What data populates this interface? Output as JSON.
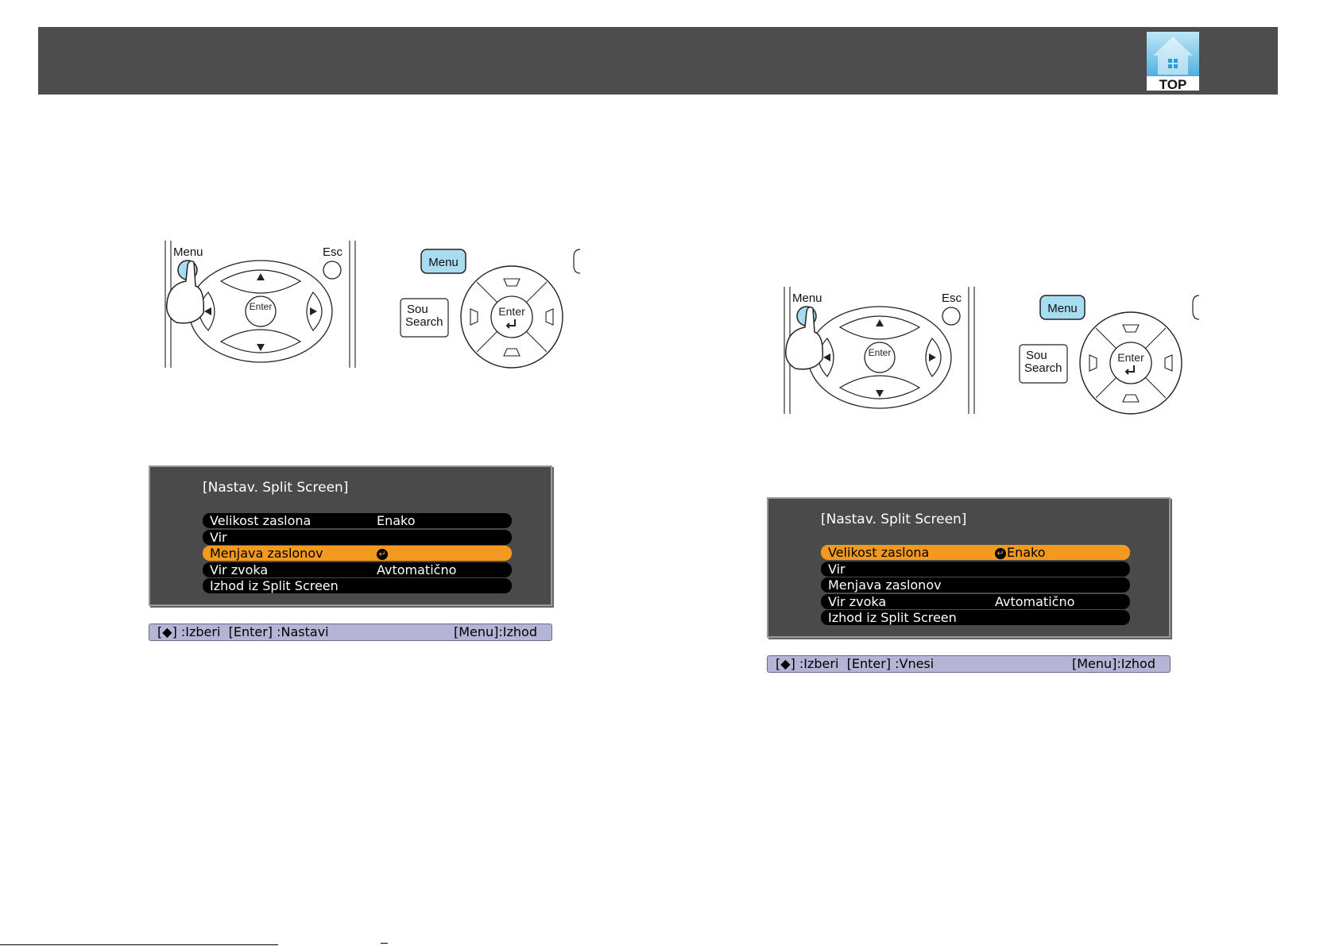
{
  "header": {
    "top_label": "TOP",
    "bar_color": "#4d4d4d",
    "top_icon": "house-icon"
  },
  "figures": [
    {
      "remote": {
        "menu_label": "Menu",
        "esc_label": "Esc",
        "enter_label": "Enter"
      },
      "panel": {
        "menu_label": "Menu",
        "source_label_1": "Sou",
        "source_label_2": "Search",
        "enter_label": "Enter"
      }
    },
    {
      "remote": {
        "menu_label": "Menu",
        "esc_label": "Esc",
        "enter_label": "Enter"
      },
      "panel": {
        "menu_label": "Menu",
        "source_label_1": "Sou",
        "source_label_2": "Search",
        "enter_label": "Enter"
      }
    }
  ],
  "menus": [
    {
      "title": "[Nastav. Split Screen]",
      "rows": [
        {
          "label": "Velikost zaslona",
          "value": "Enako"
        },
        {
          "label": "Vir",
          "value": ""
        },
        {
          "label": "Menjava zaslonov",
          "value": "",
          "selected": true,
          "enter": true
        },
        {
          "label": "Vir zvoka",
          "value": "Avtomatično"
        },
        {
          "label": "Izhod iz Split Screen",
          "value": ""
        }
      ],
      "help": {
        "select": "] :Izberi",
        "enter": "[Enter] :Nastavi",
        "exit": "[Menu]:Izhod"
      }
    },
    {
      "title": "[Nastav. Split Screen]",
      "rows": [
        {
          "label": "Velikost zaslona",
          "value": "Enako",
          "selected": true,
          "enter": true
        },
        {
          "label": "Vir",
          "value": ""
        },
        {
          "label": "Menjava zaslonov",
          "value": ""
        },
        {
          "label": "Vir zvoka",
          "value": "Avtomatično"
        },
        {
          "label": "Izhod iz Split Screen",
          "value": ""
        }
      ],
      "help": {
        "select": "] :Izberi",
        "enter": "[Enter] :Vnesi",
        "exit": "[Menu]:Izhod"
      }
    }
  ],
  "colors": {
    "osd_background": "#4a4a4a",
    "osd_selected": "#f39a1e",
    "help_bar": "#b4b4d4",
    "button_highlight": "#a8dcf0"
  }
}
